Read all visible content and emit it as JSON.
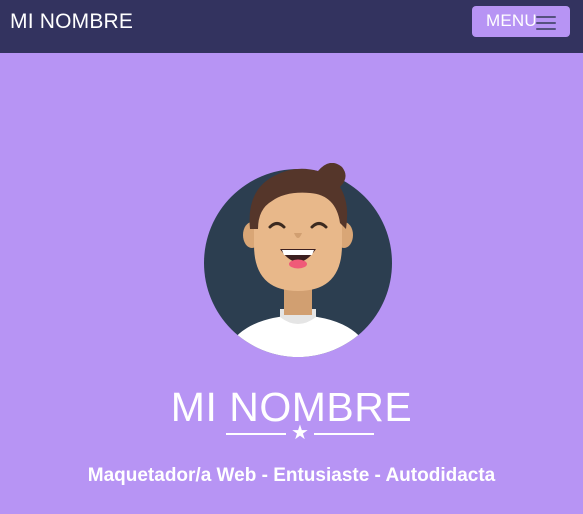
{
  "navbar": {
    "brand": "MI NOMBRE",
    "menu_label": "MENU",
    "menu_icon": "hamburger-icon"
  },
  "hero": {
    "avatar_icon": "avatar",
    "title": "MI NOMBRE",
    "divider_icon": "star-icon",
    "divider_glyph": "★",
    "subtitle": "Maquetador/a Web - Entusiaste - Autodidacta"
  },
  "colors": {
    "navbar_bg": "#33335f",
    "page_bg": "#b794f4",
    "button_bg": "#b794f4",
    "text": "#ffffff",
    "avatar_circle": "#2c3e50",
    "skin": "#e8b88a",
    "hair": "#55362a",
    "shirt": "#ffffff"
  }
}
